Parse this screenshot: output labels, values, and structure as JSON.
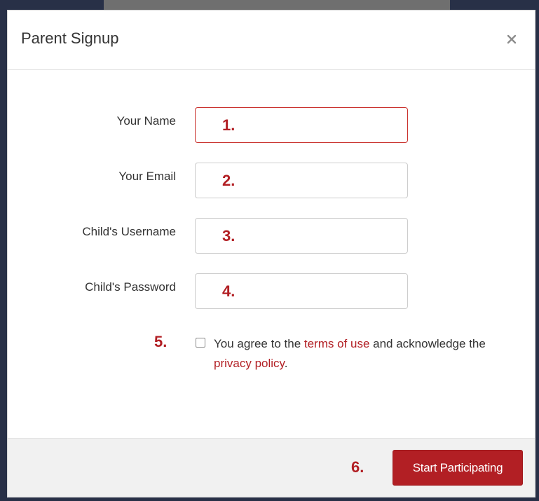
{
  "modal": {
    "title": "Parent Signup",
    "close_icon": "close-icon"
  },
  "form": {
    "fields": [
      {
        "label": "Your Name",
        "step": "1.",
        "value": "",
        "invalid": true
      },
      {
        "label": "Your Email",
        "step": "2.",
        "value": "",
        "invalid": false
      },
      {
        "label": "Child's Username",
        "step": "3.",
        "value": "",
        "invalid": false
      },
      {
        "label": "Child's Password",
        "step": "4.",
        "value": "",
        "invalid": false
      }
    ],
    "terms": {
      "step": "5.",
      "checked": false,
      "text_before": "You agree to the ",
      "terms_link": "terms of use",
      "text_middle": " and acknowledge the ",
      "privacy_link": "privacy policy",
      "text_after": "."
    }
  },
  "footer": {
    "step": "6.",
    "submit_label": "Start Participating"
  },
  "colors": {
    "accent": "#b21f24",
    "backdrop": "#283047",
    "invalid_border": "#c9302c"
  }
}
